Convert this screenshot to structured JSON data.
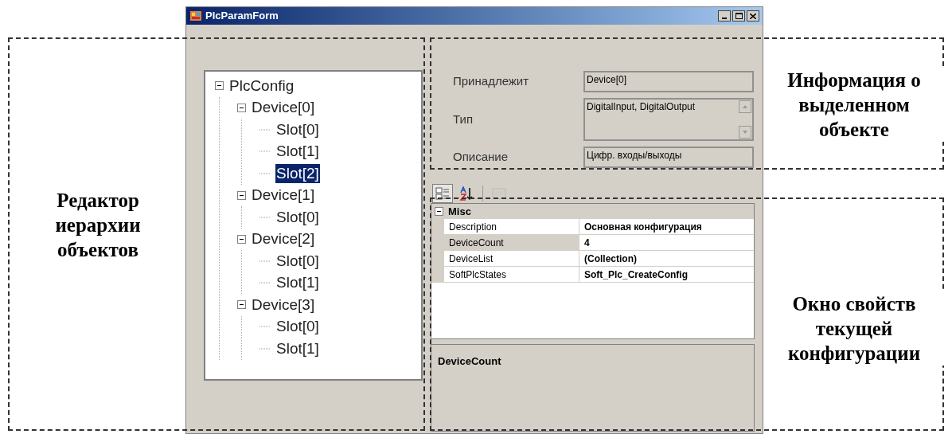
{
  "window": {
    "title": "PlcParamForm"
  },
  "tree": [
    {
      "label": "PlcConfig",
      "expanded": true,
      "selected": false,
      "children": [
        {
          "label": "Device[0]",
          "expanded": true,
          "selected": false,
          "children": [
            {
              "label": "Slot[0]",
              "selected": false
            },
            {
              "label": "Slot[1]",
              "selected": false
            },
            {
              "label": "Slot[2]",
              "selected": true
            }
          ]
        },
        {
          "label": "Device[1]",
          "expanded": true,
          "selected": false,
          "children": [
            {
              "label": "Slot[0]",
              "selected": false
            }
          ]
        },
        {
          "label": "Device[2]",
          "expanded": true,
          "selected": false,
          "children": [
            {
              "label": "Slot[0]",
              "selected": false
            },
            {
              "label": "Slot[1]",
              "selected": false
            }
          ]
        },
        {
          "label": "Device[3]",
          "expanded": true,
          "selected": false,
          "children": [
            {
              "label": "Slot[0]",
              "selected": false
            },
            {
              "label": "Slot[1]",
              "selected": false
            }
          ]
        }
      ]
    }
  ],
  "info_fields": [
    {
      "label": "Принадлежит",
      "value": "Device[0]",
      "kind": "text"
    },
    {
      "label": "Тип",
      "value": "DigitalInput, DigitalOutput",
      "kind": "multiline"
    },
    {
      "label": "Описание",
      "value": "Цифр. входы/выходы",
      "kind": "text"
    }
  ],
  "toolbar": [
    {
      "kind": "categorized",
      "selected": true,
      "disabled": false
    },
    {
      "kind": "alphabetical",
      "selected": false,
      "disabled": false
    },
    {
      "kind": "pages",
      "selected": false,
      "disabled": true
    }
  ],
  "property_grid": {
    "category": {
      "label": "Misc",
      "expanded": true
    },
    "rows": [
      {
        "name": "Description",
        "value": "Основная конфигурация",
        "selected": false
      },
      {
        "name": "DeviceCount",
        "value": "4",
        "selected": true
      },
      {
        "name": "DeviceList",
        "value": "(Collection)",
        "selected": false
      },
      {
        "name": "SoftPlcStates",
        "value": "Soft_Plc_CreateConfig",
        "selected": false
      }
    ]
  },
  "description_pane": {
    "title": "DeviceCount"
  },
  "annotations": [
    {
      "kind": "tree",
      "text": "Редактор\nиерархии\nобъектов"
    },
    {
      "kind": "info",
      "text": "Информация о\nвыделенном\nобъекте"
    },
    {
      "kind": "properties",
      "text": "Окно свойств\nтекущей\nконфигурации"
    }
  ]
}
